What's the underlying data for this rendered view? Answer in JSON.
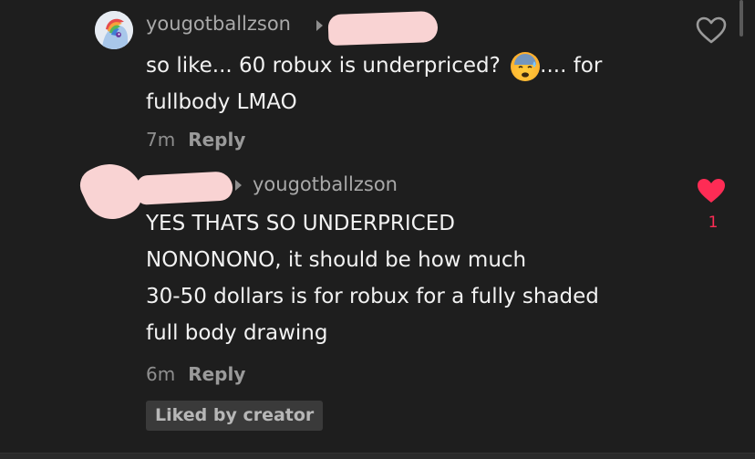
{
  "comments": [
    {
      "username": "yougotballzson",
      "text_lines": [
        "so like... 60 robux is underpriced?",
        "fullbody LMAO"
      ],
      "text_after_emoji": ".... for",
      "emoji": "anxious-face-with-sweat",
      "time": "7m",
      "reply_label": "Reply",
      "liked": false
    },
    {
      "reply_to": "yougotballzson",
      "text_lines": [
        "YES THATS SO UNDERPRICED",
        "NONONONO, it should be how much",
        "30-50 dollars is for robux for a fully shaded",
        "full body drawing"
      ],
      "time": "6m",
      "reply_label": "Reply",
      "like_count": "1",
      "liked": true,
      "badge": "Liked by creator"
    }
  ],
  "colors": {
    "background": "#1e1e1e",
    "like_red": "#fe2c55",
    "redaction": "#f9d3d3"
  },
  "icons": [
    "heart-outline-icon",
    "heart-filled-icon",
    "reply-arrow-icon"
  ]
}
